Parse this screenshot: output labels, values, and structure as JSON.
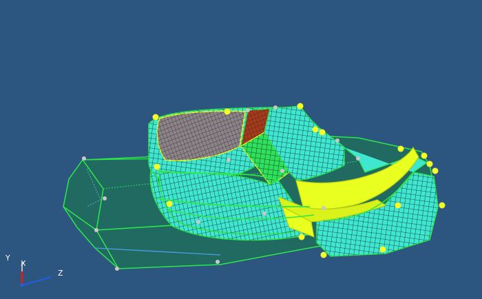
{
  "viewport": {
    "background": "#2c5580",
    "colors": {
      "housing": "#1f6e5c",
      "edge": "#2ee84a",
      "mesh_cyan": "#3fe6d0",
      "mesh_green": "#2fe05a",
      "mesh_yellow": "#e8ff20",
      "mesh_grey": "#8c8488",
      "mesh_red": "#a83a1a",
      "vertex_yellow": "#f2ff2a",
      "vertex_grey": "#c8c8c8",
      "mesh_lines": "#102020"
    }
  },
  "axes": {
    "y_label": "Y",
    "x_label": "X",
    "z_label": "Z",
    "y_color": "#e8e8e8",
    "x_color": "#d02020",
    "z_color": "#2060e0"
  }
}
